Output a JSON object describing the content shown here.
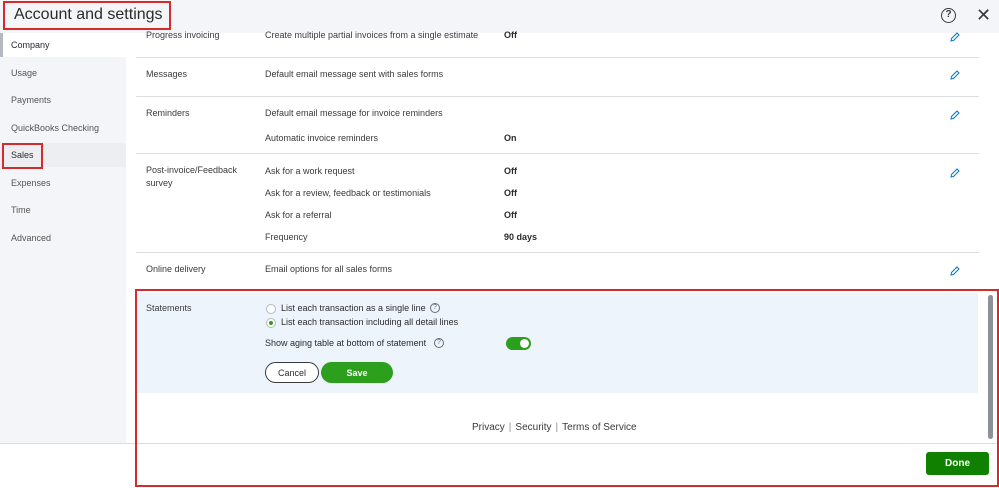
{
  "header": {
    "title": "Account and settings",
    "help_icon": "help-circle-icon",
    "close_icon": "close-icon",
    "close_glyph": "✕",
    "help_glyph": "?"
  },
  "sidebar": {
    "items": [
      {
        "label": "Company",
        "active": true
      },
      {
        "label": "Usage"
      },
      {
        "label": "Payments"
      },
      {
        "label": "QuickBooks Checking"
      },
      {
        "label": "Sales",
        "selected": true
      },
      {
        "label": "Expenses"
      },
      {
        "label": "Time"
      },
      {
        "label": "Advanced"
      }
    ]
  },
  "sections": {
    "progress_invoicing": {
      "label": "Progress invoicing",
      "desc": "Create multiple partial invoices from a single estimate",
      "value": "Off"
    },
    "messages": {
      "label": "Messages",
      "desc": "Default email message sent with sales forms"
    },
    "reminders": {
      "label": "Reminders",
      "desc1": "Default email message for invoice reminders",
      "desc2": "Automatic invoice reminders",
      "value2": "On"
    },
    "post_invoice": {
      "label": "Post-invoice/Feedback survey",
      "rows": [
        {
          "desc": "Ask for a work request",
          "value": "Off"
        },
        {
          "desc": "Ask for a review, feedback or testimonials",
          "value": "Off"
        },
        {
          "desc": "Ask for a referral",
          "value": "Off"
        },
        {
          "desc": "Frequency",
          "value": "90 days"
        }
      ]
    },
    "online_delivery": {
      "label": "Online delivery",
      "desc": "Email options for all sales forms"
    },
    "statements": {
      "label": "Statements",
      "option1": "List each transaction as a single line",
      "option2": "List each transaction including all detail lines",
      "selected_option": 2,
      "aging_label": "Show aging table at bottom of statement",
      "aging_on": true,
      "cancel_label": "Cancel",
      "save_label": "Save"
    }
  },
  "footer": {
    "privacy": "Privacy",
    "security": "Security",
    "terms": "Terms of Service",
    "sep": "|"
  },
  "done_label": "Done",
  "colors": {
    "accent_green": "#2ca01c",
    "done_green": "#108000",
    "highlight_red": "#d52b2b"
  }
}
